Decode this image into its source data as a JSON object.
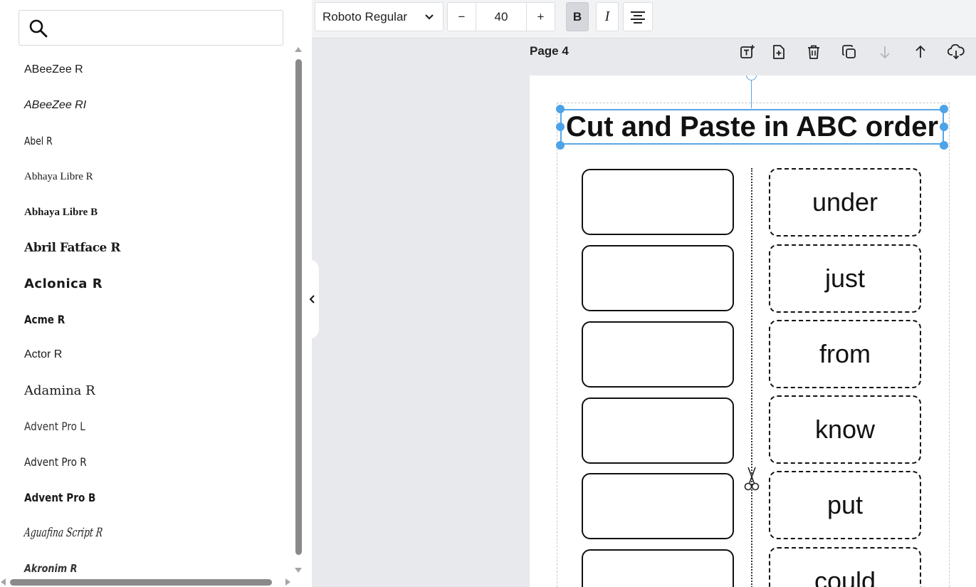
{
  "search": {
    "placeholder": "",
    "value": ""
  },
  "font_list": [
    {
      "label": "ABeeZee R"
    },
    {
      "label": "ABeeZee RI"
    },
    {
      "label": "Abel R"
    },
    {
      "label": "Abhaya Libre R"
    },
    {
      "label": "Abhaya Libre B"
    },
    {
      "label": "Abril Fatface R"
    },
    {
      "label": "Aclonica R"
    },
    {
      "label": "Acme R"
    },
    {
      "label": "Actor R"
    },
    {
      "label": "Adamina R"
    },
    {
      "label": "Advent Pro L"
    },
    {
      "label": "Advent Pro R"
    },
    {
      "label": "Advent Pro B"
    },
    {
      "label": "Aguafina Script R"
    },
    {
      "label": "Akronim R"
    }
  ],
  "toolbar": {
    "font_name": "Roboto Regular",
    "size_minus": "−",
    "font_size": "40",
    "size_plus": "+",
    "bold_label": "B",
    "italic_label": "I",
    "bold_active": true
  },
  "page": {
    "label": "Page 4",
    "title": "Cut and Paste in ABC order",
    "words": [
      "under",
      "just",
      "from",
      "know",
      "put",
      "could"
    ]
  },
  "colors": {
    "selection": "#58a6e8",
    "bold_active_bg": "#d5d7dc"
  }
}
